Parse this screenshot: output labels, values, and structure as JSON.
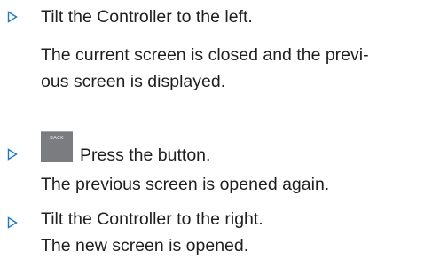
{
  "steps": [
    {
      "instruction": "Tilt the Controller to the left.",
      "result_lines": [
        "The current screen is closed and the previ-",
        "ous screen is displayed."
      ]
    },
    {
      "button_label": "BACK",
      "instruction": "Press the button.",
      "result_lines": [
        "The previous screen is opened again."
      ]
    },
    {
      "instruction": "Tilt the Controller to the right.",
      "result_lines": [
        "The new screen is opened."
      ]
    }
  ],
  "colors": {
    "bullet": "#1f78c1",
    "text": "#1f1f1f",
    "button": "#7b7c80"
  },
  "icons": {
    "bullet": "triangle-right-outline-icon"
  }
}
